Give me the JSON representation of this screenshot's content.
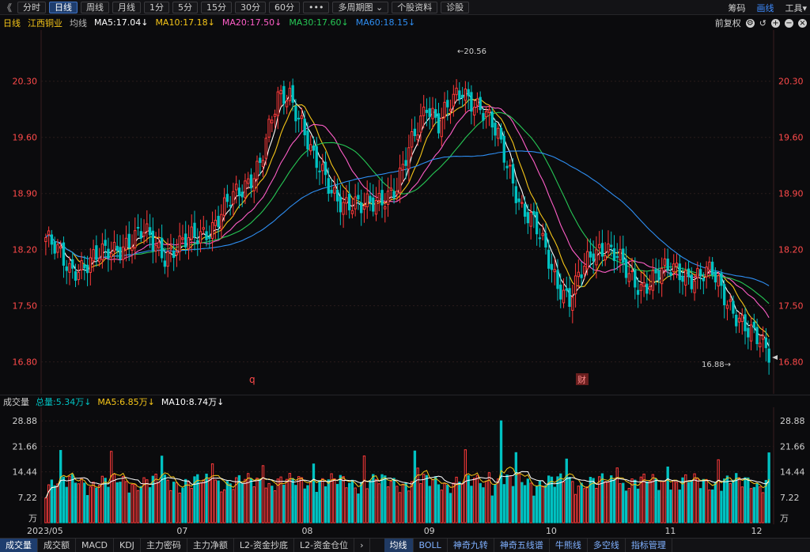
{
  "toolbar": {
    "back": "《",
    "buttons": [
      "分时",
      "日线",
      "周线",
      "月线",
      "1分",
      "5分",
      "15分",
      "30分",
      "60分",
      "•••",
      "多周期图 ⌄",
      "个股资料",
      "诊股"
    ],
    "right": [
      "筹码",
      "画线",
      "工具▾"
    ]
  },
  "legend": {
    "period": "日线",
    "name": "江西铜业",
    "avg": "均线",
    "ma5": "MA5:17.04↓",
    "ma10": "MA10:17.18↓",
    "ma20": "MA20:17.50↓",
    "ma30": "MA30:17.60↓",
    "ma60": "MA60:18.15↓",
    "adj": "前复权",
    "icons": [
      "settings-icon",
      "undo-icon",
      "zoom-in-icon",
      "zoom-out-icon",
      "close-icon"
    ]
  },
  "colors": {
    "up": "#ff3a3a",
    "down": "#00c2c2",
    "ma5": "#ffffff",
    "ma10": "#f5c518",
    "ma20": "#ff5ec8",
    "ma30": "#26c755",
    "ma60": "#2e8ef2",
    "axis": "#ff4a4a"
  },
  "price_axis": [
    "20.30",
    "19.60",
    "18.90",
    "18.20",
    "17.50",
    "16.80"
  ],
  "annotations": {
    "high": "←20.56",
    "low": "16.88→",
    "mark_q": "q",
    "mark_cai": "财"
  },
  "volume": {
    "title": "成交量",
    "total": "总量:5.34万↓",
    "ma5": "MA5:6.85万↓",
    "ma10": "MA10:8.74万↓",
    "axis": [
      "28.88",
      "21.66",
      "14.44",
      "7.22",
      "万"
    ]
  },
  "dates": [
    "2023/05",
    "07",
    "08",
    "09",
    "10",
    "11",
    "12"
  ],
  "bottom_tabs": [
    "成交量",
    "成交额",
    "MACD",
    "KDJ",
    "主力密码",
    "主力净额",
    "L2-资金抄底",
    "L2-资金仓位",
    "›"
  ],
  "indicator_tabs": [
    "均线",
    "BOLL",
    "神奇九转",
    "神奇五线谱",
    "牛熊线",
    "多空线",
    "指标管理"
  ]
}
